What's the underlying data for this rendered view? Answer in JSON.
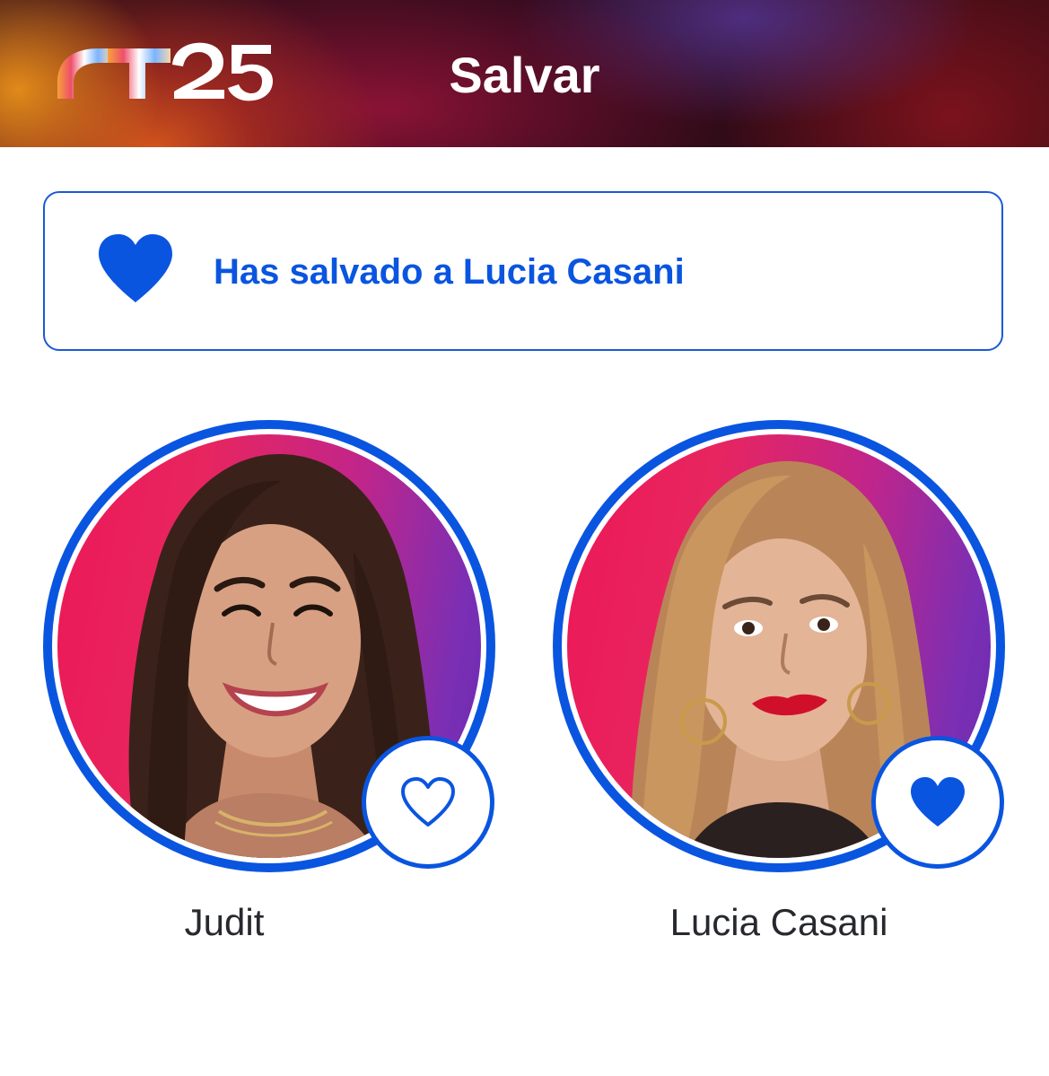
{
  "header": {
    "logo_text": "OT25",
    "title": "Salvar"
  },
  "banner": {
    "icon": "heart-filled-icon",
    "message": "Has salvado a Lucia Casani"
  },
  "candidates": [
    {
      "name": "Judit",
      "vote_icon": "heart-outline-icon",
      "saved": false
    },
    {
      "name": "Lucia Casani",
      "vote_icon": "heart-filled-icon",
      "saved": true
    }
  ],
  "colors": {
    "accent": "#0a55e0",
    "name_text": "#27292f",
    "photo_background_start": "#ec1857",
    "photo_background_end": "#6a2ab0"
  }
}
